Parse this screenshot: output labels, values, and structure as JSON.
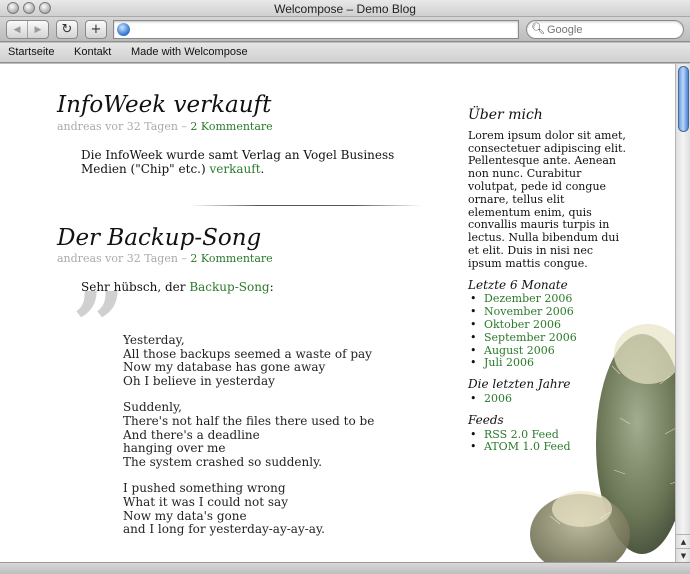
{
  "window": {
    "title": "Welcompose – Demo Blog"
  },
  "toolbar": {
    "back_icon": "back-arrow-icon",
    "forward_icon": "forward-arrow-icon",
    "reload_icon": "reload-icon",
    "add_icon": "plus-icon",
    "url": "",
    "search_placeholder": "Google"
  },
  "bookmarks": [
    {
      "label": "Startseite"
    },
    {
      "label": "Kontakt"
    },
    {
      "label": "Made with Welcompose"
    }
  ],
  "posts": [
    {
      "title": "InfoWeek verkauft",
      "meta_prefix": "andreas vor 32 Tagen –",
      "comments": "2 Kommentare",
      "body_text": "Die InfoWeek wurde samt Verlag an Vogel Business Medien (\"Chip\" etc.)",
      "body_link": "verkauft",
      "body_suffix": "."
    },
    {
      "title": "Der Backup-Song",
      "meta_prefix": "andreas vor 32 Tagen –",
      "comments": "2 Kommentare",
      "intro_text": "Sehr hübsch, der",
      "intro_link": "Backup-Song",
      "intro_suffix": ":",
      "stanzas": [
        [
          "Yesterday,",
          "All those backups seemed a waste of pay",
          "Now my database has gone away",
          "Oh I believe in yesterday"
        ],
        [
          "Suddenly,",
          "There's not half the files there used to be",
          "And there's a deadline",
          "hanging over me",
          "The system crashed so suddenly."
        ],
        [
          "I pushed something wrong",
          "What it was I could not say",
          "Now my data's gone",
          "and I long for yesterday-ay-ay-ay."
        ]
      ]
    }
  ],
  "sidebar": {
    "about_title": "Über mich",
    "about_text": "Lorem ipsum dolor sit amet, consectetuer adipiscing elit. Pellentesque ante. Aenean non nunc. Curabitur volutpat, pede id congue ornare, tellus elit elementum enim, quis convallis mauris turpis in lectus. Nulla bibendum dui et elit. Duis in nisi nec ipsum mattis congue.",
    "months_title": "Letzte 6 Monate",
    "months": [
      "Dezember 2006",
      "November 2006",
      "Oktober 2006",
      "September 2006",
      "August 2006",
      "Juli 2006"
    ],
    "years_title": "Die letzten Jahre",
    "years": [
      "2006"
    ],
    "feeds_title": "Feeds",
    "feeds": [
      "RSS 2.0 Feed",
      "ATOM 1.0 Feed"
    ]
  },
  "colors": {
    "link": "#2a7a2a",
    "meta": "#aaaaaa",
    "quote": "#d0d0d0"
  }
}
